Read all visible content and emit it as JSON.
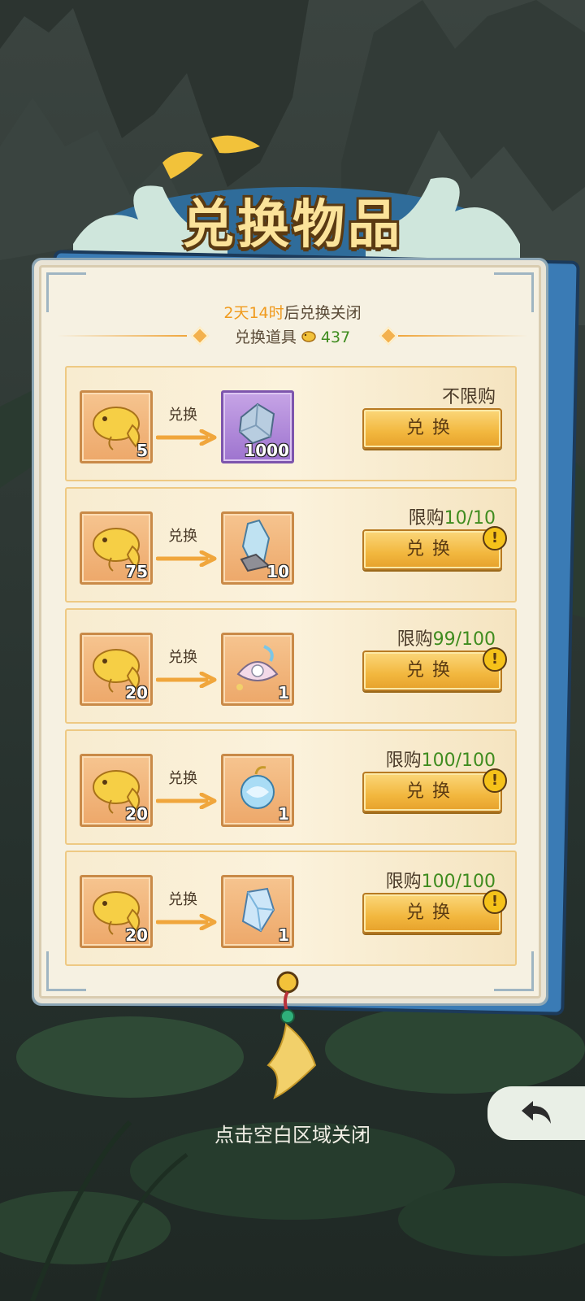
{
  "title": "兑换物品",
  "header": {
    "timer_highlight": "2天14时",
    "timer_suffix": "后兑换关闭",
    "currency_label": "兑换道具",
    "currency_icon": "golden-carp-icon",
    "currency_amount": "437"
  },
  "rows": [
    {
      "cost_icon": "golden-carp-icon",
      "cost_qty": "5",
      "arrow_label": "兑换",
      "reward_icon": "crystal-stone-icon",
      "reward_qty": "1000",
      "limit_prefix": "不限购",
      "limit_count": "",
      "button_label": "兑换",
      "has_alert": false
    },
    {
      "cost_icon": "golden-carp-icon",
      "cost_qty": "75",
      "arrow_label": "兑换",
      "reward_icon": "crystal-shard-icon",
      "reward_qty": "10",
      "limit_prefix": "限购",
      "limit_count": "10/10",
      "button_label": "兑换",
      "has_alert": true
    },
    {
      "cost_icon": "golden-carp-icon",
      "cost_qty": "20",
      "arrow_label": "兑换",
      "reward_icon": "pearl-shell-icon",
      "reward_qty": "1",
      "limit_prefix": "限购",
      "limit_count": "99/100",
      "button_label": "兑换",
      "has_alert": true
    },
    {
      "cost_icon": "golden-carp-icon",
      "cost_qty": "20",
      "arrow_label": "兑换",
      "reward_icon": "water-charm-icon",
      "reward_qty": "1",
      "limit_prefix": "限购",
      "limit_count": "100/100",
      "button_label": "兑换",
      "has_alert": true
    },
    {
      "cost_icon": "golden-carp-icon",
      "cost_qty": "20",
      "arrow_label": "兑换",
      "reward_icon": "blue-gem-icon",
      "reward_qty": "1",
      "limit_prefix": "限购",
      "limit_count": "100/100",
      "button_label": "兑换",
      "has_alert": true
    }
  ],
  "close_hint": "点击空白区域关闭",
  "alert_glyph": "!",
  "back_icon": "back-arrow-icon",
  "colors": {
    "accent_orange": "#f09a1c",
    "count_green": "#3f8c1f",
    "panel_blue": "#3a7bb5"
  }
}
